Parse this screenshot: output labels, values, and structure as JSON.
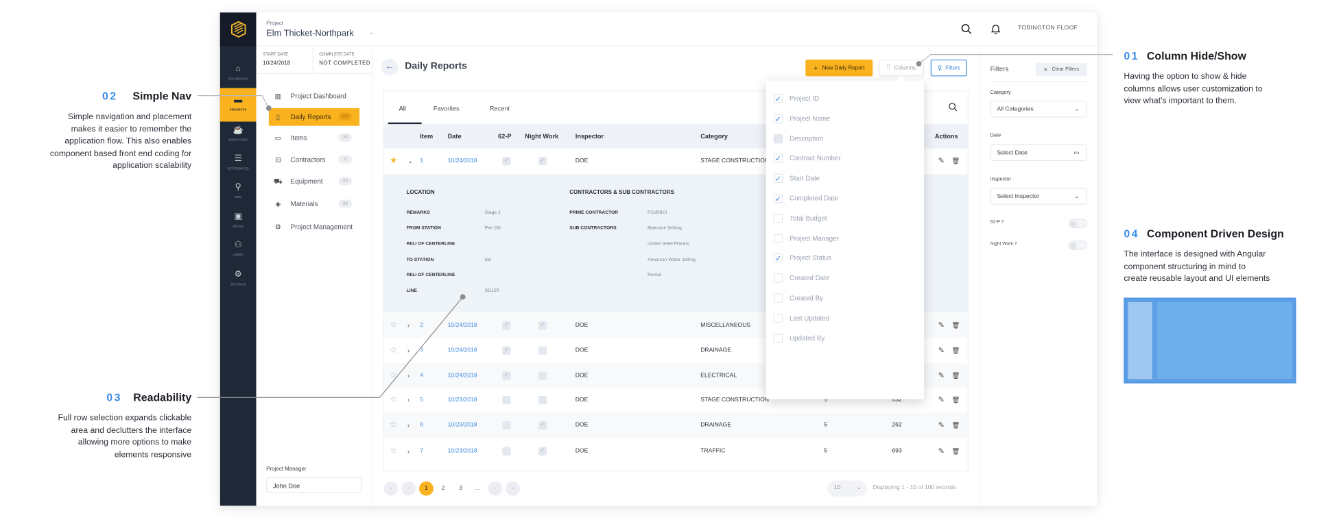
{
  "colors": {
    "accent": "#fbb21f",
    "sidebar": "#1f2837",
    "link": "#3f8be0",
    "annotation_number": "#3c8ce6"
  },
  "sidebar": {
    "items": [
      {
        "label": "DASHBOARD",
        "icon": "home-icon"
      },
      {
        "label": "PROJECTS",
        "icon": "folder-icon",
        "active": true
      },
      {
        "label": "WORKFLOW",
        "icon": "cup-icon"
      },
      {
        "label": "REFERENCES",
        "icon": "list-icon"
      },
      {
        "label": "ORG",
        "icon": "org-chart-icon"
      },
      {
        "label": "ROLES",
        "icon": "badge-icon"
      },
      {
        "label": "USERS",
        "icon": "users-icon"
      },
      {
        "label": "SETTINGS",
        "icon": "gear-icon"
      }
    ]
  },
  "header": {
    "project_label": "Project",
    "project_name": "Elm Thicket-Northpark",
    "user": "TOBINGTON FLOOF"
  },
  "project_info": {
    "start_label": "START DATE",
    "start_value": "10/24/2018",
    "complete_label": "COMPLETE DATE",
    "complete_value": "NOT COMPLETED"
  },
  "nav": [
    {
      "label": "Project Dashboard",
      "icon": "chart-icon"
    },
    {
      "label": "Daily Reports",
      "icon": "document-icon",
      "badge": "100",
      "active": true
    },
    {
      "label": "Items",
      "icon": "cash-icon",
      "badge": "33"
    },
    {
      "label": "Contractors",
      "icon": "briefcase-icon",
      "badge": "3"
    },
    {
      "label": "Equipment",
      "icon": "forklift-icon",
      "badge": "33"
    },
    {
      "label": "Materials",
      "icon": "materials-icon",
      "badge": "33"
    },
    {
      "label": "Project Management",
      "icon": "gear-icon"
    }
  ],
  "project_manager": {
    "label": "Project Manager",
    "value": "John Doe"
  },
  "main": {
    "title": "Daily Reports",
    "new_button": "New Daily Report",
    "columns_button": "Columns",
    "filters_button": "Filters",
    "tabs": [
      "All",
      "Favorites",
      "Recent"
    ],
    "headers": {
      "item": "Item",
      "date": "Date",
      "p62": "62-P",
      "night": "Night Work",
      "inspector": "Inspector",
      "category": "Category",
      "actions": "Actions"
    }
  },
  "rows": [
    {
      "starred": true,
      "expanded": true,
      "item": "1",
      "date": "10/24/2018",
      "p62": true,
      "night": true,
      "inspector": "DOE",
      "category": "STAGE CONSTRUCTION",
      "c1": "",
      "c2": ""
    },
    {
      "starred": false,
      "item": "2",
      "date": "10/24/2018",
      "p62": true,
      "night": true,
      "inspector": "DOE",
      "category": "MISCELLANEOUS",
      "c1": "",
      "c2": ""
    },
    {
      "starred": false,
      "item": "3",
      "date": "10/24/2018",
      "p62": true,
      "night": false,
      "inspector": "DOE",
      "category": "DRAINAGE",
      "c1": "",
      "c2": ""
    },
    {
      "starred": false,
      "item": "4",
      "date": "10/24/2018",
      "p62": true,
      "night": false,
      "inspector": "DOE",
      "category": "ELECTRICAL",
      "c1": "",
      "c2": ""
    },
    {
      "starred": false,
      "item": "5",
      "date": "10/23/2018",
      "p62": false,
      "night": false,
      "inspector": "DOE",
      "category": "STAGE CONSTRUCTION",
      "c1": "5",
      "c2": "632"
    },
    {
      "starred": false,
      "item": "6",
      "date": "10/23/2018",
      "p62": false,
      "night": true,
      "inspector": "DOE",
      "category": "DRAINAGE",
      "c1": "5",
      "c2": "262"
    },
    {
      "starred": false,
      "item": "7",
      "date": "10/23/2018",
      "p62": false,
      "night": true,
      "inspector": "DOE",
      "category": "TRAFFIC",
      "c1": "5",
      "c2": "693"
    }
  ],
  "expanded": {
    "location_title": "LOCATION",
    "location": [
      {
        "label": "REMARKS",
        "value": "Stage 2"
      },
      {
        "label": "FROM STATION",
        "value": "Pier 2M"
      },
      {
        "label": "RI/LI OF CENTERLINE",
        "value": ""
      },
      {
        "label": "TO STATION",
        "value": "5M"
      },
      {
        "label": "RI/LI OF CENTERLINE",
        "value": ""
      },
      {
        "label": "LINE",
        "value": "SD15R"
      }
    ],
    "contractors_title": "CONTRACTORS & SUB CONTRACTORS",
    "prime_label": "PRIME CONTRACTOR",
    "prime_value": "FCI/BBCI",
    "sub_label": "SUB CONTRACTORS",
    "subs": [
      "Malcome Drilling",
      "United Steel Placers",
      "American Water Jetting",
      "Rental"
    ]
  },
  "columns_menu": [
    {
      "label": "Project ID",
      "checked": true
    },
    {
      "label": "Project Name",
      "checked": true
    },
    {
      "label": "Description",
      "checked": false,
      "disabled": true
    },
    {
      "label": "Contract Number",
      "checked": true
    },
    {
      "label": "Start Date",
      "checked": true
    },
    {
      "label": "Completed Date",
      "checked": true
    },
    {
      "label": "Total Budget",
      "checked": false
    },
    {
      "label": "Project Manager",
      "checked": false
    },
    {
      "label": "Project Status",
      "checked": true
    },
    {
      "label": "Created Date",
      "checked": false
    },
    {
      "label": "Created By",
      "checked": false
    },
    {
      "label": "Last Updated",
      "checked": false
    },
    {
      "label": "Updated By",
      "checked": false
    }
  ],
  "pagination": {
    "pages": [
      "1",
      "2",
      "3",
      "..."
    ],
    "current": "1",
    "per_page": "10",
    "summary": "Displaying 1 - 10 of 100 records"
  },
  "filters": {
    "title": "Filters",
    "clear": "Clear Filters",
    "category_label": "Category",
    "category_value": "All Categories",
    "date_label": "Date",
    "date_placeholder": "Select Date",
    "inspector_label": "Inspector",
    "inspector_placeholder": "Select Inspector",
    "p62_label": "62-P ?",
    "p62_on": false,
    "night_label": "Night Work ?",
    "night_on": false
  },
  "annotations": [
    {
      "num": "01",
      "title": "Column Hide/Show",
      "lines": [
        "Having the option to show & hide",
        "columns allows user customization to",
        "view what's important to them."
      ]
    },
    {
      "num": "02",
      "title": "Simple Nav",
      "lines": [
        "Simple navigation and placement",
        "makes it easier to remember the",
        "application flow. This also enables",
        "component based front end coding for",
        "application scalability"
      ]
    },
    {
      "num": "03",
      "title": "Readability",
      "lines": [
        "Full row selection expands clickable",
        "area and declutters the interface",
        "allowing more options to make",
        "elements responsive"
      ]
    },
    {
      "num": "04",
      "title": "Component Driven Design",
      "lines": [
        "The interface is designed with Angular",
        "component structuring in mind to",
        "create reusable layout and UI elements"
      ]
    }
  ]
}
